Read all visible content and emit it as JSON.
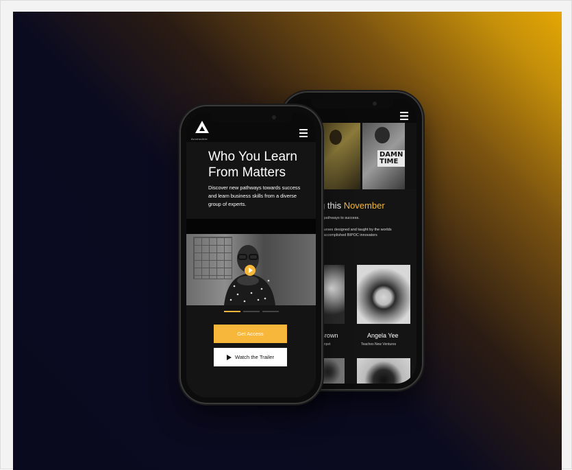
{
  "front": {
    "logo_text": "Accessible",
    "headline": "Who You Learn From Matters",
    "description": "Discover new pathways towards success and learn business skills from a diverse group of experts.",
    "carousel": {
      "count": 3,
      "active": 0
    },
    "primary_button": "Get Access",
    "secondary_button": "Watch the Trailer"
  },
  "back": {
    "title_prefix": "g this ",
    "title_highlight": "November",
    "line1": "w pathways to success.",
    "line2": "courses designed and taught by the worlds",
    "line3": "d accomplished BIPOC innovators",
    "shirt_text": "DAMN TIME",
    "instructors": [
      {
        "name": "Brown",
        "subtitle": "rumpet"
      },
      {
        "name": "Angela Yee",
        "subtitle": "Teaches New Ventures"
      }
    ]
  },
  "colors": {
    "accent": "#f6b73a",
    "dark": "#141414"
  },
  "icons": {
    "menu": "hamburger-menu-icon",
    "play": "play-icon",
    "logo": "triangle-logo"
  }
}
